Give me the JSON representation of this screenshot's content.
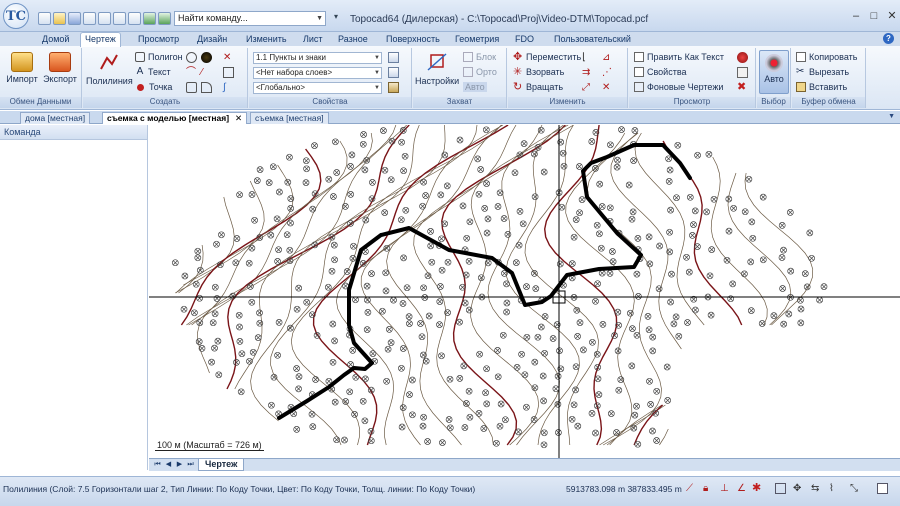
{
  "titlebar": {
    "logo_text": "TC",
    "command_placeholder": "Найти команду...",
    "title": "Topocad64 (Дилерская) - C:\\Topocad\\Proj\\Video-DTM\\Topocad.pcf",
    "minimize": "–",
    "maximize": "□",
    "close": "✕"
  },
  "tabs": [
    "Домой",
    "Чертеж",
    "Просмотр",
    "Дизайн",
    "Изменить",
    "Лист",
    "Разное",
    "Поверхность",
    "Геометрия",
    "FDO",
    "Пользовательский"
  ],
  "active_tab": "Чертеж",
  "help": "?",
  "ribbon": {
    "data_exchange": {
      "label": "Обмен Данными",
      "import": "Импорт",
      "export": "Экспорт"
    },
    "create": {
      "label": "Создать",
      "polyline": "Полилиния",
      "polygon": "Полигон",
      "text": "Текст",
      "point": "Точка"
    },
    "properties": {
      "label": "Свойства",
      "layer": "1.1 Пункты и знаки",
      "layerset": "<Нет набора слоев>",
      "scope": "<Глобально>"
    },
    "snap": {
      "label": "Захват",
      "settings": "Настройки",
      "block": "Блок",
      "ortho": "Орто",
      "auto": "Авто"
    },
    "modify": {
      "label": "Изменить",
      "move": "Переместить",
      "explode": "Взорвать",
      "rotate": "Вращать"
    },
    "view": {
      "label": "Просмотр",
      "edit_text": "Править Как Текст",
      "props": "Свойства",
      "bg_drawings": "Фоновые Чертежи"
    },
    "select": {
      "label": "Выбор",
      "auto": "Авто"
    },
    "clipboard": {
      "label": "Буфер обмена",
      "copy": "Копировать",
      "cut": "Вырезать",
      "paste": "Вставить"
    }
  },
  "doc_tabs": [
    "дома [местная]",
    "съемка с моделью [местная]",
    "съемка [местная]"
  ],
  "active_doc_tab": "съемка с моделью [местная]",
  "doc_tab_close": "✕",
  "left_panel": {
    "header": "Команда"
  },
  "scale_label": "100 м (Масштаб = 726 м)",
  "sheet_tab": "Чертеж",
  "status": {
    "text": "Полилиния (Слой: 7.5 Горизонтали шаг 2, Тип Линии: По Коду Точки, Цвет: По Коду Точки, Толщ. линии: По Коду Точки)",
    "coords": "5913783.098 m  387833.495 m"
  },
  "colors": {
    "contour": "#6b5a44",
    "index_contour": "#7a1418",
    "polyline": "#000000",
    "crosshair": "#000000",
    "accent": "#2e67c2"
  }
}
